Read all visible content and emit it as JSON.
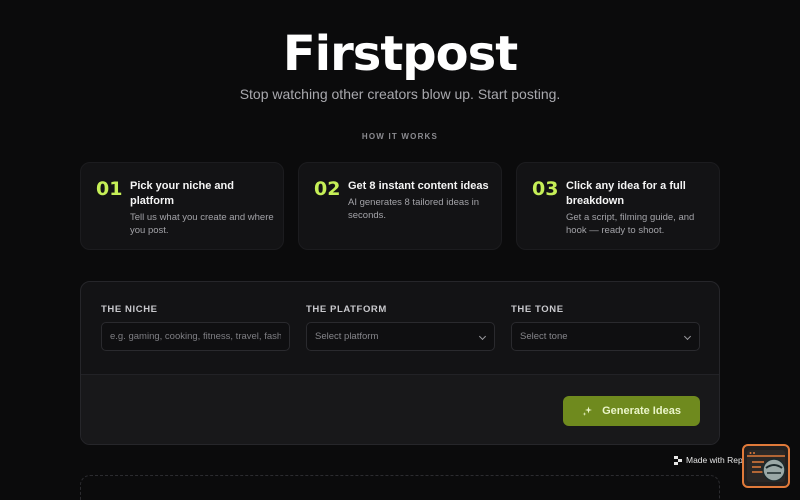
{
  "hero": {
    "title": "Firstpost",
    "subtitle": "Stop watching other creators blow up. Start posting."
  },
  "how_it_works": {
    "label": "HOW IT WORKS",
    "steps": [
      {
        "number": "01",
        "title": "Pick your niche and platform",
        "description": "Tell us what you create and where you post."
      },
      {
        "number": "02",
        "title": "Get 8 instant content ideas",
        "description": "AI generates 8 tailored ideas in seconds."
      },
      {
        "number": "03",
        "title": "Click any idea for a full breakdown",
        "description": "Get a script, filming guide, and hook — ready to shoot."
      }
    ]
  },
  "form": {
    "niche": {
      "label": "THE NICHE",
      "placeholder": "e.g. gaming, cooking, fitness, travel, fashion"
    },
    "platform": {
      "label": "THE PLATFORM",
      "selected": "Select platform"
    },
    "tone": {
      "label": "THE TONE",
      "selected": "Select tone"
    },
    "generate_label": "Generate Ideas"
  },
  "badge": {
    "label": "Made with Replit"
  },
  "colors": {
    "accent": "#c6ef57",
    "button": "#6f8a1e",
    "background": "#0b0b0c",
    "card": "#131315",
    "chat_border": "#e07a3a"
  },
  "icons": {
    "generate": "sparkles-icon",
    "dropdown": "chevron-down-icon",
    "badge": "replit-logo-icon",
    "chat": "chat-widget-icon"
  }
}
